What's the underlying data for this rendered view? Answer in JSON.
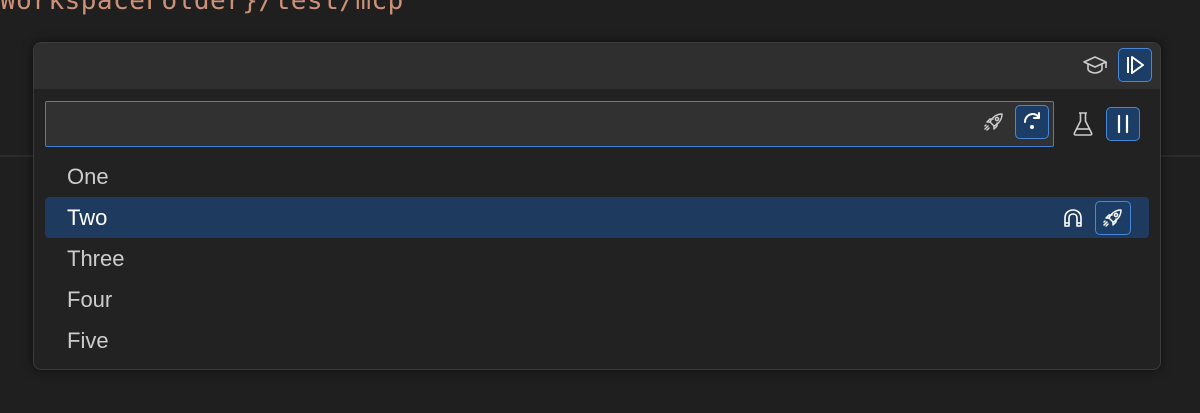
{
  "editor": {
    "code_line": "WorkspaceFolder}/test/mcp"
  },
  "quick_pick": {
    "title_actions": [
      {
        "name": "learn-icon",
        "checked": false
      },
      {
        "name": "step-into-icon",
        "checked": true
      }
    ],
    "input": {
      "value": "",
      "placeholder": ""
    },
    "input_actions": [
      {
        "name": "rocket-icon",
        "checked": false
      },
      {
        "name": "redo-icon",
        "checked": true
      }
    ],
    "outer_actions": [
      {
        "name": "beaker-icon",
        "checked": false
      },
      {
        "name": "pause-icon",
        "checked": true
      }
    ],
    "items": [
      {
        "label": "One",
        "selected": false
      },
      {
        "label": "Two",
        "selected": true,
        "actions": [
          "magnet-icon",
          "rocket-icon"
        ]
      },
      {
        "label": "Three",
        "selected": false
      },
      {
        "label": "Four",
        "selected": false
      },
      {
        "label": "Five",
        "selected": false
      }
    ]
  },
  "colors": {
    "accent_border": "#3f7fd6",
    "checked_bg": "#1c3d66",
    "selected_row": "#1e3a5f",
    "code_string": "#ce9178"
  }
}
